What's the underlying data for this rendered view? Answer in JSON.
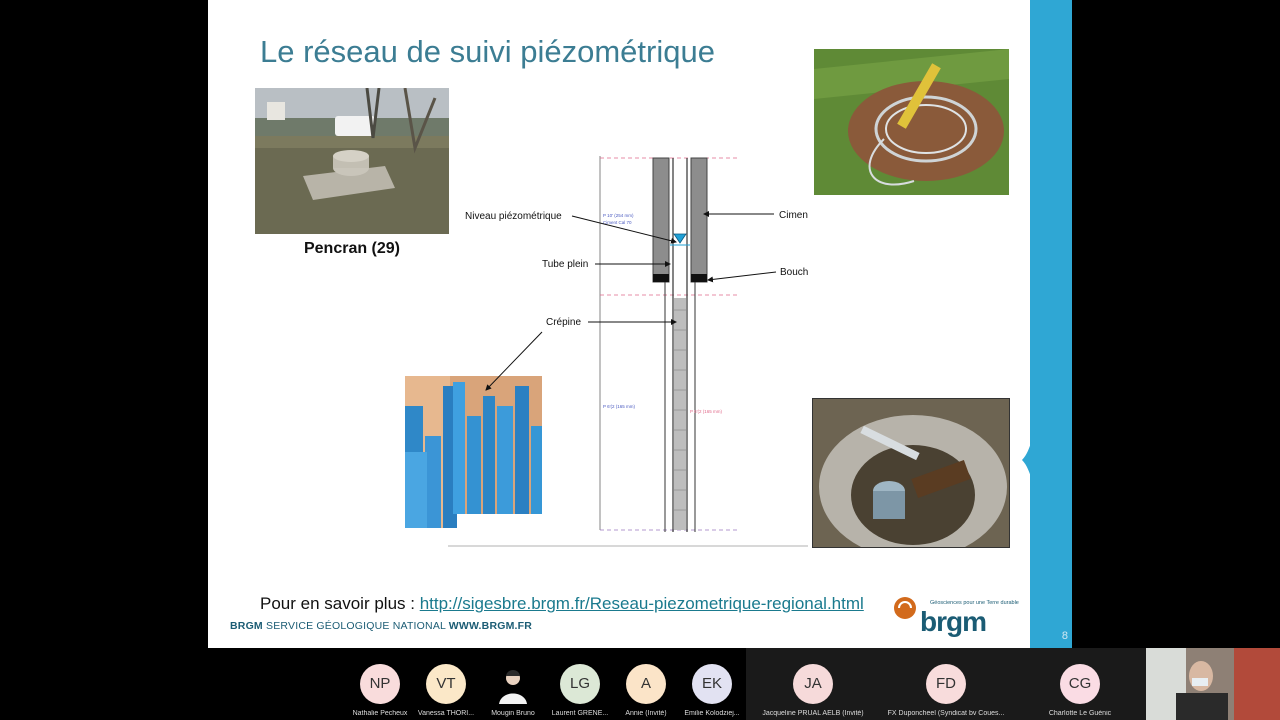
{
  "slide": {
    "title": "Le réseau de suivi piézométrique",
    "photo_caption": "Pencran (29)",
    "more_label": "Pour en savoir plus : ",
    "more_link": "http://sigesbre.brgm.fr/Reseau-piezometrique-regional.html",
    "footer_brand": "BRGM",
    "footer_text": " SERVICE GÉOLOGIQUE NATIONAL ",
    "footer_site": "WWW.BRGM.FR",
    "logo_word": "brgm",
    "logo_tagline": "Géosciences pour une Terre durable",
    "page_number": "8",
    "diagram": {
      "niveau": "Niveau piézométrique",
      "tube": "Tube plein",
      "crepine": "Crépine",
      "ciment": "Ciment",
      "bouchon": "Bouchon",
      "dim1": "P 10' (254 mm)",
      "dim1b": "Ciment Cal 70",
      "dim2": "P 6'(2 (165 mm)",
      "dim3": "P 6'(2 (165 mm)"
    }
  },
  "participants": [
    {
      "initials": "NP",
      "name": "Nathalie Pecheux",
      "color": "#f9dcdc"
    },
    {
      "initials": "VT",
      "name": "Vanessa THORI...",
      "color": "#fbe8c8"
    },
    {
      "initials": "",
      "name": "Mougin Bruno",
      "color": "#000000"
    },
    {
      "initials": "LG",
      "name": "Laurent GRENE...",
      "color": "#dce8d6"
    },
    {
      "initials": "A",
      "name": "Annie (Invité)",
      "color": "#fbe4c8"
    },
    {
      "initials": "EK",
      "name": "Emilie Kolodziej...",
      "color": "#e2e2f2"
    },
    {
      "initials": "JA",
      "name": "Jacqueline PRUAL AELB (Invité)",
      "color": "#f6dada"
    },
    {
      "initials": "FD",
      "name": "FX Duponcheel (Syndicat bv Coues...",
      "color": "#f8dcdc"
    },
    {
      "initials": "CG",
      "name": "Charlotte Le Guénic",
      "color": "#fadce4"
    }
  ]
}
